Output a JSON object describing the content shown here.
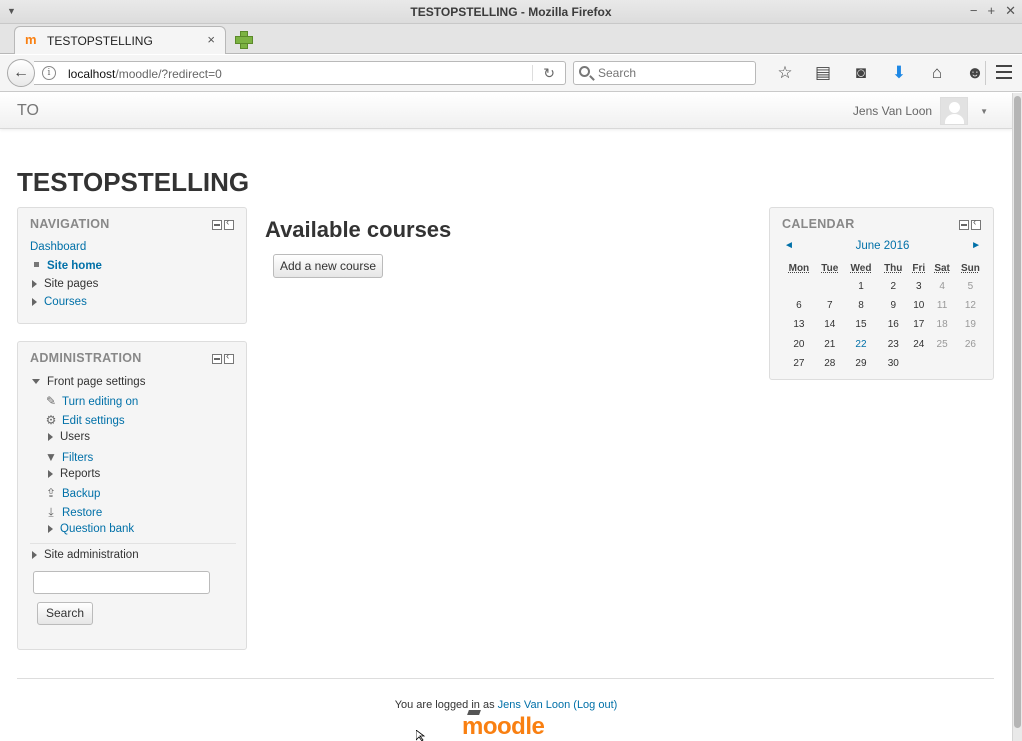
{
  "window": {
    "title": "TESTOPSTELLING - Mozilla Firefox",
    "controls": [
      "−",
      "+",
      "✕"
    ]
  },
  "tab": {
    "favicon": "moodle-favicon",
    "title": "TESTOPSTELLING",
    "close": "×"
  },
  "urlbar": {
    "host": "localhost",
    "path": "/moodle/?redirect=0"
  },
  "search": {
    "placeholder": "Search"
  },
  "toolbar": {
    "icons": [
      "star-icon",
      "reading-list-icon",
      "pocket-icon",
      "download-icon",
      "home-icon",
      "smiley-icon",
      "hamburger-menu-icon"
    ]
  },
  "moodle": {
    "brand": "TO",
    "user_name": "Jens Van Loon",
    "page_heading": "TESTOPSTELLING"
  },
  "navigation": {
    "title": "NAVIGATION",
    "dashboard": "Dashboard",
    "site_home": "Site home",
    "site_pages": "Site pages",
    "courses": "Courses"
  },
  "administration": {
    "title": "ADMINISTRATION",
    "front_page_settings": "Front page settings",
    "turn_editing_on": "Turn editing on",
    "edit_settings": "Edit settings",
    "users": "Users",
    "filters": "Filters",
    "reports": "Reports",
    "backup": "Backup",
    "restore": "Restore",
    "question_bank": "Question bank",
    "site_administration": "Site administration",
    "search_value": "",
    "search_button": "Search"
  },
  "main": {
    "heading": "Available courses",
    "add_course_button": "Add a new course"
  },
  "calendar": {
    "title": "CALENDAR",
    "prev": "◄",
    "next": "►",
    "month": "June 2016",
    "weekdays": [
      "Mon",
      "Tue",
      "Wed",
      "Thu",
      "Fri",
      "Sat",
      "Sun"
    ],
    "weeks": [
      [
        "",
        "",
        "1",
        "2",
        "3",
        "4",
        "5"
      ],
      [
        "6",
        "7",
        "8",
        "9",
        "10",
        "11",
        "12"
      ],
      [
        "13",
        "14",
        "15",
        "16",
        "17",
        "18",
        "19"
      ],
      [
        "20",
        "21",
        "22",
        "23",
        "24",
        "25",
        "26"
      ],
      [
        "27",
        "28",
        "29",
        "30",
        "",
        "",
        ""
      ]
    ],
    "today": "22"
  },
  "footer": {
    "logged_in_prefix": "You are logged in as ",
    "user_link": "Jens Van Loon",
    "logout_link": "(Log out)",
    "logo_text": "moodle"
  }
}
